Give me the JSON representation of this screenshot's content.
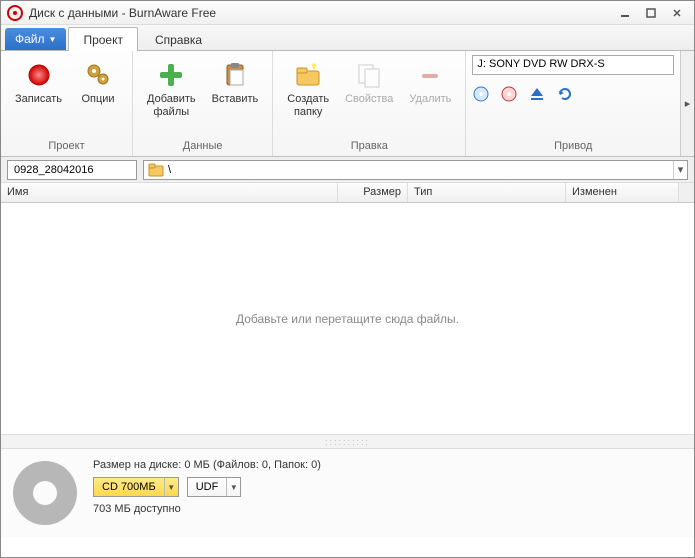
{
  "window": {
    "title": "Диск с данными - BurnAware Free"
  },
  "menu": {
    "file": "Файл",
    "tabs": [
      "Проект",
      "Справка"
    ],
    "active_tab": 0
  },
  "ribbon": {
    "groups": [
      {
        "label": "Проект",
        "buttons": [
          {
            "label": "Записать",
            "icon": "record"
          },
          {
            "label": "Опции",
            "icon": "gears"
          }
        ]
      },
      {
        "label": "Данные",
        "buttons": [
          {
            "label": "Добавить\nфайлы",
            "icon": "plus"
          },
          {
            "label": "Вставить",
            "icon": "paste"
          }
        ]
      },
      {
        "label": "Правка",
        "buttons": [
          {
            "label": "Создать\nпапку",
            "icon": "newfolder"
          },
          {
            "label": "Свойства",
            "icon": "props",
            "disabled": true
          },
          {
            "label": "Удалить",
            "icon": "delete",
            "disabled": true
          }
        ]
      }
    ],
    "drive_group_label": "Привод",
    "drive": "J: SONY DVD RW DRX-S"
  },
  "path": {
    "compilation": "0928_28042016",
    "folder": "\\"
  },
  "columns": {
    "name": "Имя",
    "size": "Размер",
    "type": "Тип",
    "modified": "Изменен"
  },
  "filearea_hint": "Добавьте или перетащите сюда файлы.",
  "footer": {
    "summary": "Размер на диске: 0 МБ (Файлов: 0, Папок: 0)",
    "disc_type": "CD 700МБ",
    "fs_type": "UDF",
    "available": "703 МБ доступно"
  }
}
